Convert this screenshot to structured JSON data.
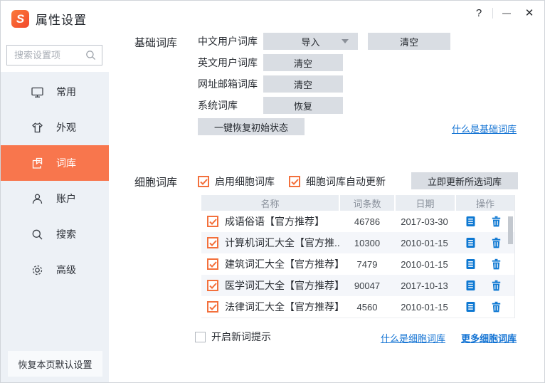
{
  "window": {
    "title": "属性设置",
    "help": "?",
    "minimize": "—",
    "close": "✕"
  },
  "colors": {
    "accent_orange": "#f8764d",
    "check_orange": "#f3703c",
    "link_blue": "#1172d3",
    "icon_blue": "#0e78d2",
    "sidebar_bg": "#edf1f6",
    "button_gray": "#d9dde3"
  },
  "sidebar": {
    "search_placeholder": "搜索设置项",
    "items": [
      {
        "label": "常用",
        "icon": "monitor-icon",
        "selected": false
      },
      {
        "label": "外观",
        "icon": "tshirt-icon",
        "selected": false
      },
      {
        "label": "词库",
        "icon": "dictionary-icon",
        "selected": true
      },
      {
        "label": "账户",
        "icon": "user-icon",
        "selected": false
      },
      {
        "label": "搜索",
        "icon": "search-icon",
        "selected": false
      },
      {
        "label": "高级",
        "icon": "gear-icon",
        "selected": false
      }
    ],
    "restore_defaults": "恢复本页默认设置"
  },
  "base_dict": {
    "title": "基础词库",
    "chinese_user_dict": {
      "label": "中文用户词库",
      "import": "导入",
      "clear": "清空"
    },
    "english_user_dict": {
      "label": "英文用户词库",
      "clear": "清空"
    },
    "url_email_dict": {
      "label": "网址邮箱词库",
      "clear": "清空"
    },
    "system_dict": {
      "label": "系统词库",
      "restore": "恢复"
    },
    "reset_all": "一键恢复初始状态",
    "help_link": "什么是基础词库"
  },
  "cell_dict": {
    "title": "细胞词库",
    "enable": {
      "label": "启用细胞词库",
      "checked": true
    },
    "auto_update": {
      "label": "细胞词库自动更新",
      "checked": true
    },
    "update_now": "立即更新所选词库",
    "table": {
      "headers": [
        "名称",
        "词条数",
        "日期",
        "操作"
      ],
      "rows": [
        {
          "checked": true,
          "name": "成语俗语【官方推荐】",
          "count": "46786",
          "date": "2017-03-30"
        },
        {
          "checked": true,
          "name": "计算机词汇大全【官方推...",
          "count": "10300",
          "date": "2010-01-15"
        },
        {
          "checked": true,
          "name": "建筑词汇大全【官方推荐】",
          "count": "7479",
          "date": "2010-01-15"
        },
        {
          "checked": true,
          "name": "医学词汇大全【官方推荐】",
          "count": "90047",
          "date": "2017-10-13"
        },
        {
          "checked": true,
          "name": "法律词汇大全【官方推荐】",
          "count": "4560",
          "date": "2010-01-15"
        }
      ]
    },
    "new_word_tip": {
      "label": "开启新词提示",
      "checked": false
    },
    "what_is_link": "什么是细胞词库",
    "more_link": "更多细胞词库"
  }
}
